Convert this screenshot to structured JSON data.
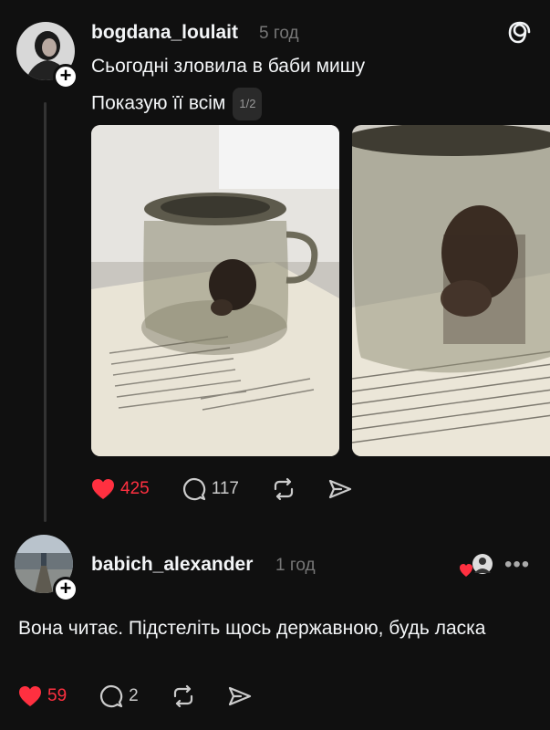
{
  "post": {
    "username": "bogdana_loulait",
    "time": "5 год",
    "line1": "Сьогодні зловила в баби мишу",
    "line2": "Показую її всім",
    "counter": "1/2",
    "actions": {
      "likes": "425",
      "comments": "117"
    }
  },
  "reply": {
    "username": "babich_alexander",
    "time": "1 год",
    "text": "Вона читає. Підстеліть щось державною, будь ласка",
    "actions": {
      "likes": "59",
      "comments": "2"
    }
  },
  "icons": {
    "logo": "threads-logo",
    "like": "heart-icon",
    "comment": "comment-icon",
    "repost": "repost-icon",
    "share": "share-icon",
    "more": "more-icon"
  },
  "colors": {
    "like_red": "#ff3040",
    "background": "#101010"
  }
}
